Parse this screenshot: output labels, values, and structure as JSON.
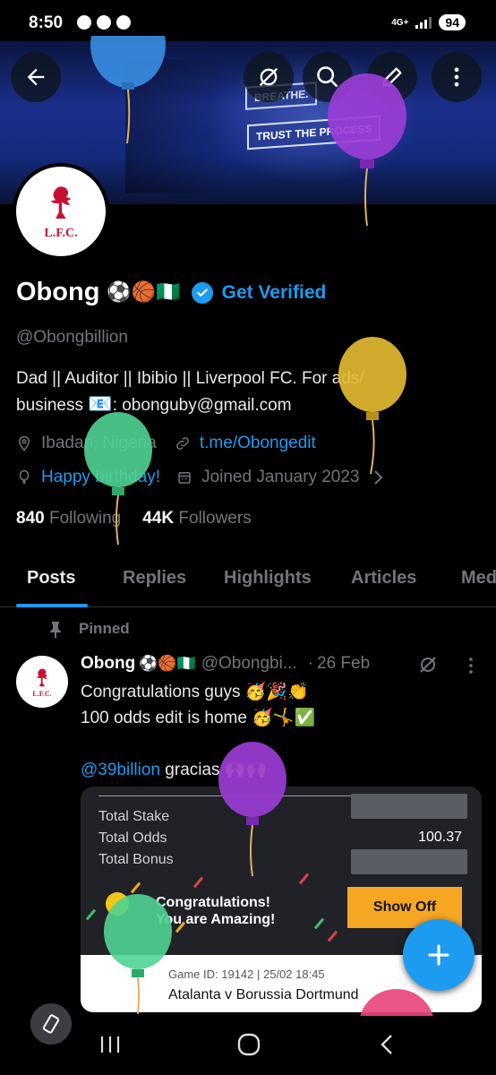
{
  "status": {
    "time": "8:50",
    "network": "4G+",
    "battery": "94"
  },
  "banner": {
    "sign_top": "BREATHE.",
    "sign_bottom": "TRUST THE PROCESS"
  },
  "header_actions": [
    "back-icon",
    "grok-icon",
    "search-icon",
    "edit-icon",
    "more-icon"
  ],
  "profile": {
    "avatar_text": "L.F.C.",
    "name": "Obong",
    "name_emojis": "⚽🏀🇳🇬",
    "get_verified": "Get Verified",
    "handle": "@Obongbillion",
    "bio_line1": "Dad || Auditor || Ibibio || Liverpool FC. For ads/",
    "bio_line2_prefix": "business ",
    "bio_line2_emoji": "📧",
    "bio_line2_suffix": ": obonguby@gmail.com",
    "location": "Ibadan, Nigeria",
    "website": "t.me/Obongedit",
    "birthday": "Happy birthday!",
    "joined": "Joined January 2023",
    "following_count": "840",
    "following_label": "Following",
    "followers_count": "44K",
    "followers_label": "Followers"
  },
  "tabs": [
    {
      "label": "Posts",
      "active": true
    },
    {
      "label": "Replies"
    },
    {
      "label": "Highlights"
    },
    {
      "label": "Articles"
    },
    {
      "label": "Media"
    }
  ],
  "pinned_post": {
    "pinned_label": "Pinned",
    "author": "Obong",
    "author_emojis": "⚽🏀🇳🇬",
    "handle": "@Obongbi...",
    "separator": "·",
    "date": "26 Feb",
    "line1": "Congratulations guys 🥳🎉👏",
    "line2": "100 odds edit is home 🥳🤸✅",
    "mention": "@39billion",
    "mention_suffix": " gracias 🙌🙌",
    "card": {
      "total_stake": "Total Stake",
      "total_odds": "Total Odds",
      "total_odds_value": "100.37",
      "total_bonus": "Total Bonus",
      "congrats_line1": "Congratulations!",
      "congrats_line2": "You are Amazing!",
      "show_off": "Show Off",
      "game_id": "Game ID: 19142 | 25/02 18:45",
      "match": "Atalanta v Borussia Dortmund"
    }
  },
  "colors": {
    "accent": "#1d9bf0",
    "background": "#000000",
    "muted": "#71767b",
    "show_off": "#f5a623"
  }
}
